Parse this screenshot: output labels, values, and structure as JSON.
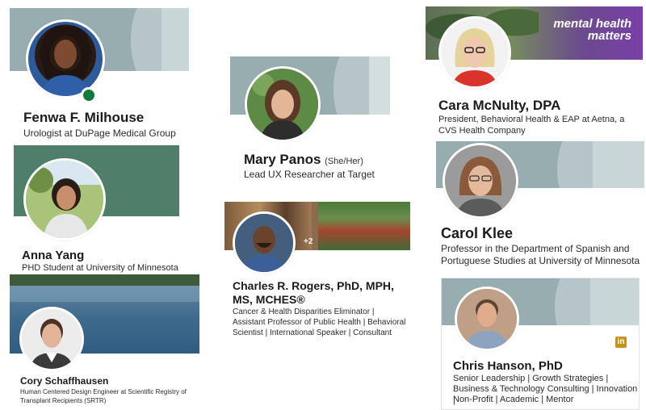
{
  "colors": {
    "banner_slate": "#98adb0",
    "banner_light": "#c9d6d7",
    "banner_green": "#4f7f6a",
    "purple": "#6f3f9e",
    "online": "#127a3c",
    "linkedin_gold": "#c7921c"
  },
  "profiles": [
    {
      "name": "Fenwa F. Milhouse",
      "headline": "Urologist at DuPage Medical Group",
      "status": "online"
    },
    {
      "name": "Mary Panos",
      "pronouns": "(She/Her)",
      "headline": "Lead UX Researcher at Target"
    },
    {
      "name": "Cara McNulty, DPA",
      "headline_1": "President, Behavioral Health & EAP at Aetna, a",
      "headline_2": "CVS Health Company",
      "banner_text_1": "mental health",
      "banner_text_2": "matters"
    },
    {
      "name": "Anna Yang",
      "headline": "PHD Student at University of Minnesota"
    },
    {
      "name": "Charles R. Rogers, PhD, MPH,",
      "name_2": "MS, MCHES®",
      "headline_1": "Cancer & Health Disparities Eliminator |",
      "headline_2": "Assistant Professor of Public Health | Behavioral",
      "headline_3": "Scientist | International Speaker | Consultant",
      "badge": "+2"
    },
    {
      "name": "Carol Klee",
      "headline_1": "Professor in the Department of Spanish and",
      "headline_2": "Portuguese Studies at University of Minnesota"
    },
    {
      "name": "Cory Schaffhausen",
      "headline_1": "Human Centered Design Engineer at Scientific Registry of",
      "headline_2": "Transplant Recipients (SRTR)"
    },
    {
      "name": "Chris Hanson, PhD",
      "headline_1": "Senior Leadership | Growth Strategies |",
      "headline_2": "Business & Technology Consulting | Innovation |",
      "headline_3": "Non-Profit | Academic | Mentor",
      "icon": "linkedin-icon",
      "icon_text": "in"
    }
  ]
}
